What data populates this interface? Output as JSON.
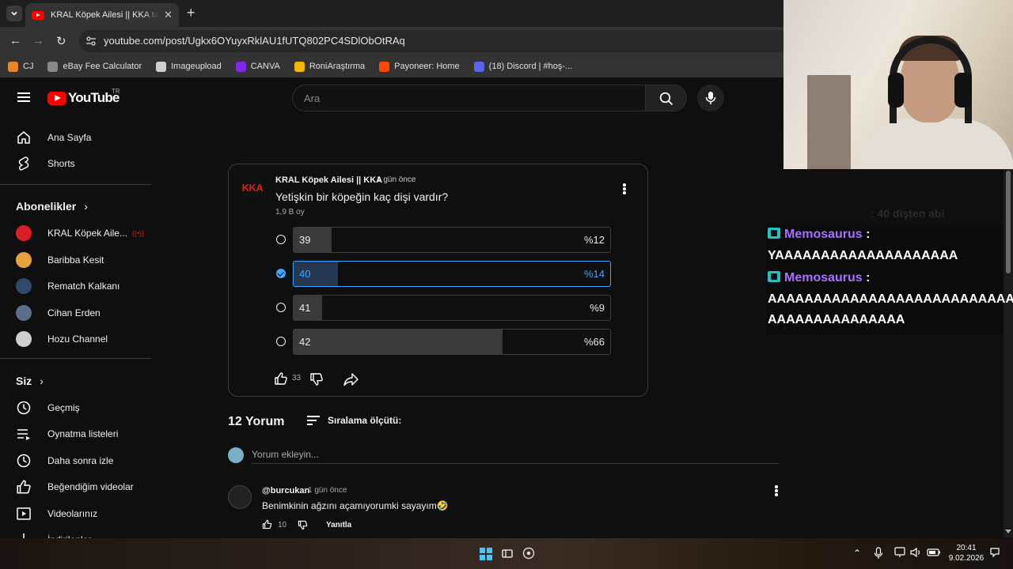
{
  "browser": {
    "tab_title": "KRAL Köpek Ailesi || KKA tarafından",
    "url": "youtube.com/post/Ugkx6OYuyxRklAU1fUTQ802PC4SDlObOtRAq",
    "bookmarks": [
      {
        "label": "CJ",
        "color": "#e8862a"
      },
      {
        "label": "eBay Fee Calculator",
        "color": "#888888"
      },
      {
        "label": "Imageupload",
        "color": "#cfcfcf"
      },
      {
        "label": "CANVA",
        "color": "#7d2ae8"
      },
      {
        "label": "RoniAraştırma",
        "color": "#f2b705"
      },
      {
        "label": "Payoneer: Home",
        "color": "#ff4800"
      },
      {
        "label": "(18) Discord | #hoş-...",
        "color": "#5865f2"
      }
    ]
  },
  "youtube": {
    "logo_text": "YouTube",
    "country": "TR",
    "search_placeholder": "Ara",
    "sidebar": {
      "main": [
        {
          "label": "Ana Sayfa",
          "icon": "home-icon"
        },
        {
          "label": "Shorts",
          "icon": "shorts-icon"
        }
      ],
      "subscriptions_title": "Abonelikler",
      "subscriptions": [
        {
          "label": "KRAL Köpek Aile...",
          "color": "#d81f26",
          "live": true
        },
        {
          "label": "Baribba Kesit",
          "color": "#e9a23b"
        },
        {
          "label": "Rematch Kalkanı",
          "color": "#2f4a6b"
        },
        {
          "label": "Cihan Erden",
          "color": "#5a6f89"
        },
        {
          "label": "Hozu Channel",
          "color": "#cfcfcf"
        }
      ],
      "you_title": "Siz",
      "you_items": [
        {
          "label": "Geçmiş",
          "icon": "history-icon"
        },
        {
          "label": "Oynatma listeleri",
          "icon": "playlists-icon"
        },
        {
          "label": "Daha sonra izle",
          "icon": "watch-later-icon"
        },
        {
          "label": "Beğendiğim videolar",
          "icon": "liked-icon"
        },
        {
          "label": "Videolarınız",
          "icon": "your-videos-icon"
        },
        {
          "label": "İndirilenler",
          "icon": "downloads-icon"
        }
      ]
    },
    "post": {
      "avatar_text": "KKA",
      "author": "KRAL Köpek Ailesi || KKA",
      "time": "1 gün önce",
      "question": "Yetişkin bir köpeğin kaç dişi vardır?",
      "votes": "1,9 B oy",
      "options": [
        {
          "label": "39",
          "percent_text": "%12",
          "percent": 12,
          "selected": false
        },
        {
          "label": "40",
          "percent_text": "%14",
          "percent": 14,
          "selected": true
        },
        {
          "label": "41",
          "percent_text": "%9",
          "percent": 9,
          "selected": false
        },
        {
          "label": "42",
          "percent_text": "%66",
          "percent": 66,
          "selected": false
        }
      ],
      "likes": "33"
    },
    "comments": {
      "count_label": "12 Yorum",
      "sort_label": "Sıralama ölçütü:",
      "add_placeholder": "Yorum ekleyin...",
      "items": [
        {
          "user": "@burcukan",
          "time": "1 gün önce",
          "text": "Benimkinin ağzını açamıyorumki sayayım🤣",
          "likes": "10",
          "reply_label": "Yanıtla"
        }
      ]
    }
  },
  "chat": {
    "ghost_text": ": 40 dişten abi",
    "messages": [
      {
        "user": "Memosaurus",
        "sep": " :",
        "lines": [
          "YAAAAAAAAAAAAAAAAAAAA"
        ]
      },
      {
        "user": "Memosaurus",
        "sep": " :",
        "lines": [
          "AAAAAAAAAAAAAAAAAAAAAAAAAAA",
          "AAAAAAAAAAAAAAA"
        ]
      }
    ]
  },
  "taskbar": {
    "time": "20:41",
    "date": "9.02.2026"
  }
}
